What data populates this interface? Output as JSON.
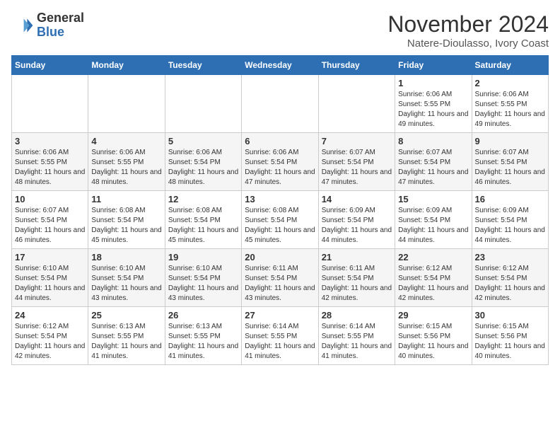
{
  "header": {
    "logo_general": "General",
    "logo_blue": "Blue",
    "month_title": "November 2024",
    "location": "Natere-Dioulasso, Ivory Coast"
  },
  "weekdays": [
    "Sunday",
    "Monday",
    "Tuesday",
    "Wednesday",
    "Thursday",
    "Friday",
    "Saturday"
  ],
  "weeks": [
    [
      {
        "day": "",
        "info": ""
      },
      {
        "day": "",
        "info": ""
      },
      {
        "day": "",
        "info": ""
      },
      {
        "day": "",
        "info": ""
      },
      {
        "day": "",
        "info": ""
      },
      {
        "day": "1",
        "info": "Sunrise: 6:06 AM\nSunset: 5:55 PM\nDaylight: 11 hours and 49 minutes."
      },
      {
        "day": "2",
        "info": "Sunrise: 6:06 AM\nSunset: 5:55 PM\nDaylight: 11 hours and 49 minutes."
      }
    ],
    [
      {
        "day": "3",
        "info": "Sunrise: 6:06 AM\nSunset: 5:55 PM\nDaylight: 11 hours and 48 minutes."
      },
      {
        "day": "4",
        "info": "Sunrise: 6:06 AM\nSunset: 5:55 PM\nDaylight: 11 hours and 48 minutes."
      },
      {
        "day": "5",
        "info": "Sunrise: 6:06 AM\nSunset: 5:54 PM\nDaylight: 11 hours and 48 minutes."
      },
      {
        "day": "6",
        "info": "Sunrise: 6:06 AM\nSunset: 5:54 PM\nDaylight: 11 hours and 47 minutes."
      },
      {
        "day": "7",
        "info": "Sunrise: 6:07 AM\nSunset: 5:54 PM\nDaylight: 11 hours and 47 minutes."
      },
      {
        "day": "8",
        "info": "Sunrise: 6:07 AM\nSunset: 5:54 PM\nDaylight: 11 hours and 47 minutes."
      },
      {
        "day": "9",
        "info": "Sunrise: 6:07 AM\nSunset: 5:54 PM\nDaylight: 11 hours and 46 minutes."
      }
    ],
    [
      {
        "day": "10",
        "info": "Sunrise: 6:07 AM\nSunset: 5:54 PM\nDaylight: 11 hours and 46 minutes."
      },
      {
        "day": "11",
        "info": "Sunrise: 6:08 AM\nSunset: 5:54 PM\nDaylight: 11 hours and 45 minutes."
      },
      {
        "day": "12",
        "info": "Sunrise: 6:08 AM\nSunset: 5:54 PM\nDaylight: 11 hours and 45 minutes."
      },
      {
        "day": "13",
        "info": "Sunrise: 6:08 AM\nSunset: 5:54 PM\nDaylight: 11 hours and 45 minutes."
      },
      {
        "day": "14",
        "info": "Sunrise: 6:09 AM\nSunset: 5:54 PM\nDaylight: 11 hours and 44 minutes."
      },
      {
        "day": "15",
        "info": "Sunrise: 6:09 AM\nSunset: 5:54 PM\nDaylight: 11 hours and 44 minutes."
      },
      {
        "day": "16",
        "info": "Sunrise: 6:09 AM\nSunset: 5:54 PM\nDaylight: 11 hours and 44 minutes."
      }
    ],
    [
      {
        "day": "17",
        "info": "Sunrise: 6:10 AM\nSunset: 5:54 PM\nDaylight: 11 hours and 44 minutes."
      },
      {
        "day": "18",
        "info": "Sunrise: 6:10 AM\nSunset: 5:54 PM\nDaylight: 11 hours and 43 minutes."
      },
      {
        "day": "19",
        "info": "Sunrise: 6:10 AM\nSunset: 5:54 PM\nDaylight: 11 hours and 43 minutes."
      },
      {
        "day": "20",
        "info": "Sunrise: 6:11 AM\nSunset: 5:54 PM\nDaylight: 11 hours and 43 minutes."
      },
      {
        "day": "21",
        "info": "Sunrise: 6:11 AM\nSunset: 5:54 PM\nDaylight: 11 hours and 42 minutes."
      },
      {
        "day": "22",
        "info": "Sunrise: 6:12 AM\nSunset: 5:54 PM\nDaylight: 11 hours and 42 minutes."
      },
      {
        "day": "23",
        "info": "Sunrise: 6:12 AM\nSunset: 5:54 PM\nDaylight: 11 hours and 42 minutes."
      }
    ],
    [
      {
        "day": "24",
        "info": "Sunrise: 6:12 AM\nSunset: 5:54 PM\nDaylight: 11 hours and 42 minutes."
      },
      {
        "day": "25",
        "info": "Sunrise: 6:13 AM\nSunset: 5:55 PM\nDaylight: 11 hours and 41 minutes."
      },
      {
        "day": "26",
        "info": "Sunrise: 6:13 AM\nSunset: 5:55 PM\nDaylight: 11 hours and 41 minutes."
      },
      {
        "day": "27",
        "info": "Sunrise: 6:14 AM\nSunset: 5:55 PM\nDaylight: 11 hours and 41 minutes."
      },
      {
        "day": "28",
        "info": "Sunrise: 6:14 AM\nSunset: 5:55 PM\nDaylight: 11 hours and 41 minutes."
      },
      {
        "day": "29",
        "info": "Sunrise: 6:15 AM\nSunset: 5:56 PM\nDaylight: 11 hours and 40 minutes."
      },
      {
        "day": "30",
        "info": "Sunrise: 6:15 AM\nSunset: 5:56 PM\nDaylight: 11 hours and 40 minutes."
      }
    ]
  ]
}
